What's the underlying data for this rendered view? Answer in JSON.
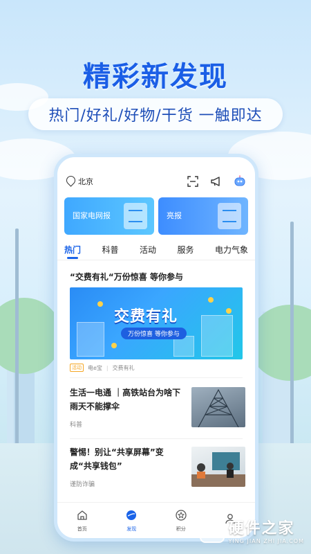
{
  "headline": "精彩新发现",
  "subline": "热门/好礼/好物/干货  一触即达",
  "app": {
    "location": "北京",
    "top_icons": [
      "scan-icon",
      "megaphone-icon",
      "robot-assistant-icon"
    ],
    "cards": [
      {
        "label": "国家电网报",
        "icon": "newspaper-icon"
      },
      {
        "label": "亮报",
        "icon": "scroll-icon"
      }
    ],
    "tabs": [
      {
        "label": "热门",
        "active": true
      },
      {
        "label": "科普",
        "active": false
      },
      {
        "label": "活动",
        "active": false
      },
      {
        "label": "服务",
        "active": false
      },
      {
        "label": "电力气象",
        "active": false
      }
    ],
    "feed": {
      "featured": {
        "title": "“交费有礼“万份惊喜  等你参与",
        "banner_title": "交费有礼",
        "banner_subtitle": "万份惊喜 等你参与",
        "tag": "活动",
        "source": "电e宝",
        "topic": "交费有礼"
      },
      "items": [
        {
          "title": "生活一电通  ｜高铁站台为啥下雨天不能撑伞",
          "category": "科普",
          "thumb": "power-tower-photo"
        },
        {
          "title": "警惕！别让“共享屏幕”变成“共享钱包”",
          "category": "谨防诈骗",
          "thumb": "office-meeting-photo"
        }
      ]
    },
    "bottom_nav": [
      {
        "label": "首页",
        "icon": "home-icon",
        "active": false
      },
      {
        "label": "发现",
        "icon": "discover-icon",
        "active": true
      },
      {
        "label": "积分",
        "icon": "points-icon",
        "active": false
      },
      {
        "label": "",
        "icon": "profile-icon",
        "active": false
      }
    ]
  },
  "watermark": {
    "cn": "硬件之家",
    "en": "YING JIAN ZHI JIA.COM"
  },
  "colors": {
    "brand_blue": "#1a63e8",
    "headline_blue": "#1a5ee6",
    "tag_orange": "#f5a623"
  }
}
